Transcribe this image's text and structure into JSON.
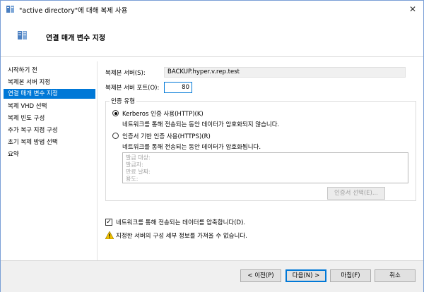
{
  "window": {
    "title": "\"active directory\"에 대해 복제 사용",
    "close": "✕"
  },
  "header": {
    "title": "연결 매개 변수 지정"
  },
  "nav": {
    "items": [
      {
        "label": "시작하기 전",
        "active": false
      },
      {
        "label": "복제본 서버 지정",
        "active": false
      },
      {
        "label": "연결 매개 변수 지정",
        "active": true
      },
      {
        "label": "복제 VHD 선택",
        "active": false
      },
      {
        "label": "복제 빈도 구성",
        "active": false
      },
      {
        "label": "추가 복구 지점 구성",
        "active": false
      },
      {
        "label": "초기 복제 방법 선택",
        "active": false
      },
      {
        "label": "요약",
        "active": false
      }
    ]
  },
  "form": {
    "server_label": "복제본 서버(S):",
    "server_value": "BACKUP.hyper.v.rep.test",
    "port_label": "복제본 서버 포트(O):",
    "port_value": "80",
    "auth_group_title": "인증 유형",
    "kerberos_label": "Kerberos 인증 사용(HTTP)(K)",
    "kerberos_desc": "네트워크를 통해 전송되는 동안 데이터가 암호화되지 않습니다.",
    "cert_label": "인증서 기반 인증 사용(HTTPS)(R)",
    "cert_desc": "네트워크를 통해 전송되는 동안 데이터가 암호화됩니다.",
    "cert_fields": [
      "발급 대상:",
      "발급자:",
      "만료 날짜:",
      "용도:"
    ],
    "select_cert_button": "인증서 선택(E)...",
    "compress_label": "네트워크를 통해 전송되는 데이터를 압축합니다(D).",
    "compress_checked": true,
    "warning_text": "지정한 서버의 구성 세부 정보를 가져올 수 없습니다."
  },
  "footer": {
    "prev": "< 이전(P)",
    "next": "다음(N) >",
    "finish": "마침(F)",
    "cancel": "취소"
  },
  "colors": {
    "accent": "#0078d7",
    "warning": "#f2c200"
  }
}
